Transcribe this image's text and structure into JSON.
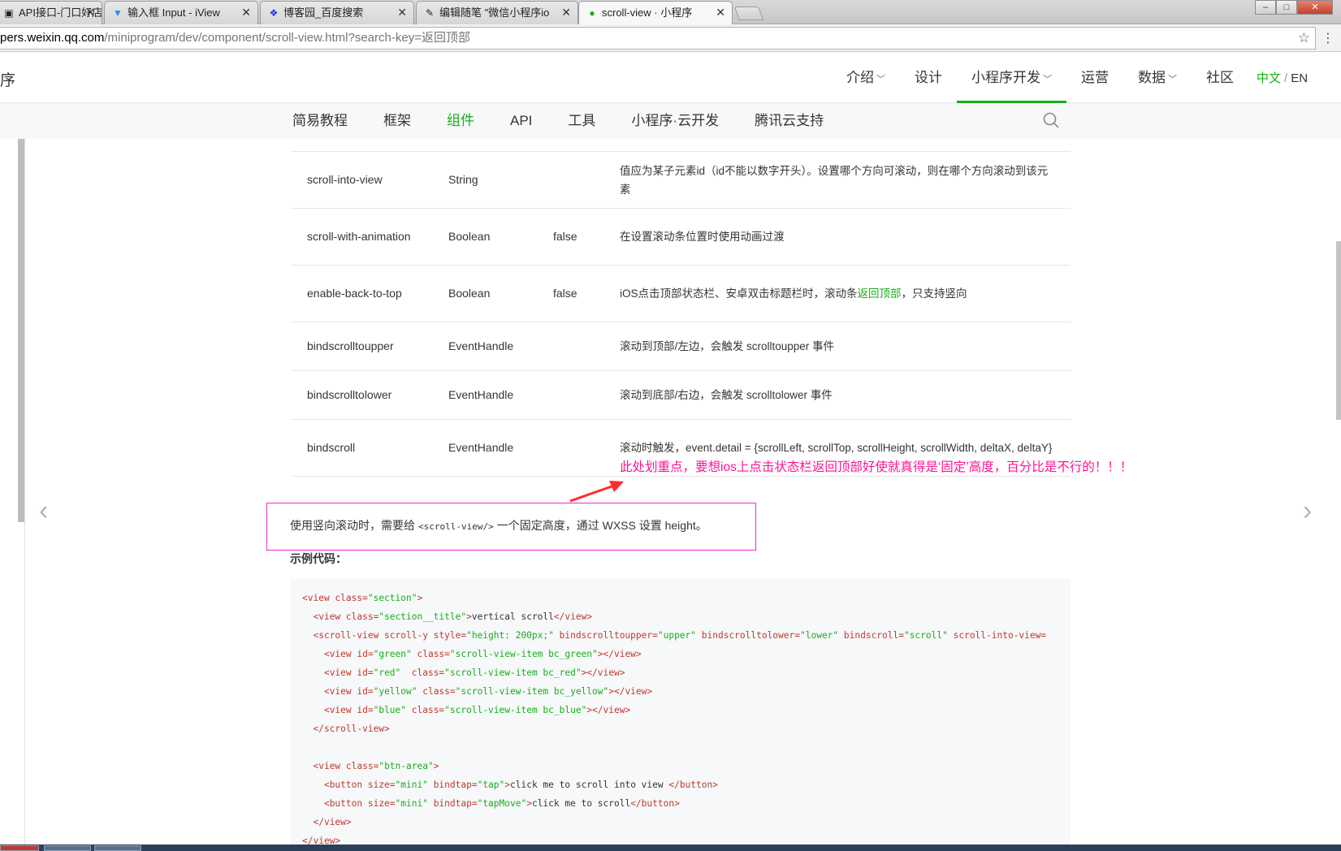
{
  "browser": {
    "tabs": [
      {
        "label": "API接口-门口好店",
        "icon": "▣"
      },
      {
        "label": "输入框 Input - iView",
        "icon": "▼"
      },
      {
        "label": "博客园_百度搜索",
        "icon": "❖"
      },
      {
        "label": "编辑随笔 \"微信小程序io",
        "icon": "✎"
      },
      {
        "label": "scroll-view · 小程序",
        "icon": "●"
      }
    ],
    "close_glyph": "✕",
    "url_host": "pers.weixin.qq.com",
    "url_path": "/miniprogram/dev/component/scroll-view.html?search-key=返回顶部",
    "star_glyph": "☆",
    "menu_glyph": "⋮",
    "win_minimize": "–",
    "win_maximize": "□",
    "win_close": "✕"
  },
  "header": {
    "logo_text": "序",
    "nav": [
      {
        "label": "介绍",
        "chevron": "﹀"
      },
      {
        "label": "设计"
      },
      {
        "label": "小程序开发",
        "chevron": "﹀"
      },
      {
        "label": "运营"
      },
      {
        "label": "数据",
        "chevron": "﹀"
      },
      {
        "label": "社区"
      }
    ],
    "lang_zh": "中文",
    "lang_sep": "/",
    "lang_en": "EN"
  },
  "subnav": {
    "items": [
      "简易教程",
      "框架",
      "组件",
      "API",
      "工具",
      "小程序·云开发",
      "腾讯云支持"
    ]
  },
  "table": {
    "rows": [
      {
        "name": "scroll-into-view",
        "type": "String",
        "default": "",
        "desc": "值应为某子元素id（id不能以数字开头）。设置哪个方向可滚动，则在哪个方向滚动到该元素"
      },
      {
        "name": "scroll-with-animation",
        "type": "Boolean",
        "default": "false",
        "desc": "在设置滚动条位置时使用动画过渡"
      },
      {
        "name": "enable-back-to-top",
        "type": "Boolean",
        "default": "false",
        "desc_before": "iOS点击顶部状态栏、安卓双击标题栏时，滚动条",
        "desc_link": "返回顶部",
        "desc_after": "，只支持竖向"
      },
      {
        "name": "bindscrolltoupper",
        "type": "EventHandle",
        "default": "",
        "desc": "滚动到顶部/左边，会触发 scrolltoupper 事件"
      },
      {
        "name": "bindscrolltolower",
        "type": "EventHandle",
        "default": "",
        "desc": "滚动到底部/右边，会触发 scrolltolower 事件"
      },
      {
        "name": "bindscroll",
        "type": "EventHandle",
        "default": "",
        "desc": "滚动时触发，event.detail = {scrollLeft, scrollTop, scrollHeight, scrollWidth, deltaX, deltaY}"
      }
    ]
  },
  "annotation": {
    "text": "此处划重点，要想ios上点击状态栏返回顶部好使就真得是‘固定’高度，百分比是不行的！！！",
    "arrow_color": "#ff2a2a",
    "box_color": "#e82bd0"
  },
  "note": {
    "before": "使用竖向滚动时，需要给",
    "code": "<scroll-view/>",
    "after": "一个固定高度，通过 WXSS 设置 height。"
  },
  "example_title": "示例代码：",
  "code_lines": [
    [
      [
        "t",
        "<view "
      ],
      [
        "a",
        "class="
      ],
      [
        "v",
        "\"section\""
      ],
      [
        "t",
        ">"
      ]
    ],
    [
      [
        "x",
        "  "
      ],
      [
        "t",
        "<view "
      ],
      [
        "a",
        "class="
      ],
      [
        "v",
        "\"section__title\""
      ],
      [
        "t",
        ">"
      ],
      [
        "x",
        "vertical scroll"
      ],
      [
        "t",
        "</view>"
      ]
    ],
    [
      [
        "x",
        "  "
      ],
      [
        "t",
        "<scroll-view "
      ],
      [
        "a",
        "scroll-y style="
      ],
      [
        "v",
        "\"height: 200px;\""
      ],
      [
        "a",
        " bindscrolltoupper="
      ],
      [
        "v",
        "\"upper\""
      ],
      [
        "a",
        " bindscrolltolower="
      ],
      [
        "v",
        "\"lower\""
      ],
      [
        "a",
        " bindscroll="
      ],
      [
        "v",
        "\"scroll\""
      ],
      [
        "a",
        " scroll-into-view="
      ]
    ],
    [
      [
        "x",
        "    "
      ],
      [
        "t",
        "<view "
      ],
      [
        "a",
        "id="
      ],
      [
        "v",
        "\"green\""
      ],
      [
        "a",
        " class="
      ],
      [
        "v",
        "\"scroll-view-item bc_green\""
      ],
      [
        "t",
        "></view>"
      ]
    ],
    [
      [
        "x",
        "    "
      ],
      [
        "t",
        "<view "
      ],
      [
        "a",
        "id="
      ],
      [
        "v",
        "\"red\""
      ],
      [
        "a",
        "  class="
      ],
      [
        "v",
        "\"scroll-view-item bc_red\""
      ],
      [
        "t",
        "></view>"
      ]
    ],
    [
      [
        "x",
        "    "
      ],
      [
        "t",
        "<view "
      ],
      [
        "a",
        "id="
      ],
      [
        "v",
        "\"yellow\""
      ],
      [
        "a",
        " class="
      ],
      [
        "v",
        "\"scroll-view-item bc_yellow\""
      ],
      [
        "t",
        "></view>"
      ]
    ],
    [
      [
        "x",
        "    "
      ],
      [
        "t",
        "<view "
      ],
      [
        "a",
        "id="
      ],
      [
        "v",
        "\"blue\""
      ],
      [
        "a",
        " class="
      ],
      [
        "v",
        "\"scroll-view-item bc_blue\""
      ],
      [
        "t",
        "></view>"
      ]
    ],
    [
      [
        "x",
        "  "
      ],
      [
        "t",
        "</scroll-view>"
      ]
    ],
    [
      [
        "x",
        ""
      ]
    ],
    [
      [
        "x",
        "  "
      ],
      [
        "t",
        "<view "
      ],
      [
        "a",
        "class="
      ],
      [
        "v",
        "\"btn-area\""
      ],
      [
        "t",
        ">"
      ]
    ],
    [
      [
        "x",
        "    "
      ],
      [
        "t",
        "<button "
      ],
      [
        "a",
        "size="
      ],
      [
        "v",
        "\"mini\""
      ],
      [
        "a",
        " bindtap="
      ],
      [
        "v",
        "\"tap\""
      ],
      [
        "t",
        ">"
      ],
      [
        "x",
        "click me to scroll into view "
      ],
      [
        "t",
        "</button>"
      ]
    ],
    [
      [
        "x",
        "    "
      ],
      [
        "t",
        "<button "
      ],
      [
        "a",
        "size="
      ],
      [
        "v",
        "\"mini\""
      ],
      [
        "a",
        " bindtap="
      ],
      [
        "v",
        "\"tapMove\""
      ],
      [
        "t",
        ">"
      ],
      [
        "x",
        "click me to scroll"
      ],
      [
        "t",
        "</button>"
      ]
    ],
    [
      [
        "x",
        "  "
      ],
      [
        "t",
        "</view>"
      ]
    ],
    [
      [
        "t",
        "</view>"
      ]
    ]
  ],
  "page_arrows": {
    "prev": "‹",
    "next": "›"
  },
  "colors": {
    "accent": "#1aad19",
    "annotation": "#ff1493"
  }
}
